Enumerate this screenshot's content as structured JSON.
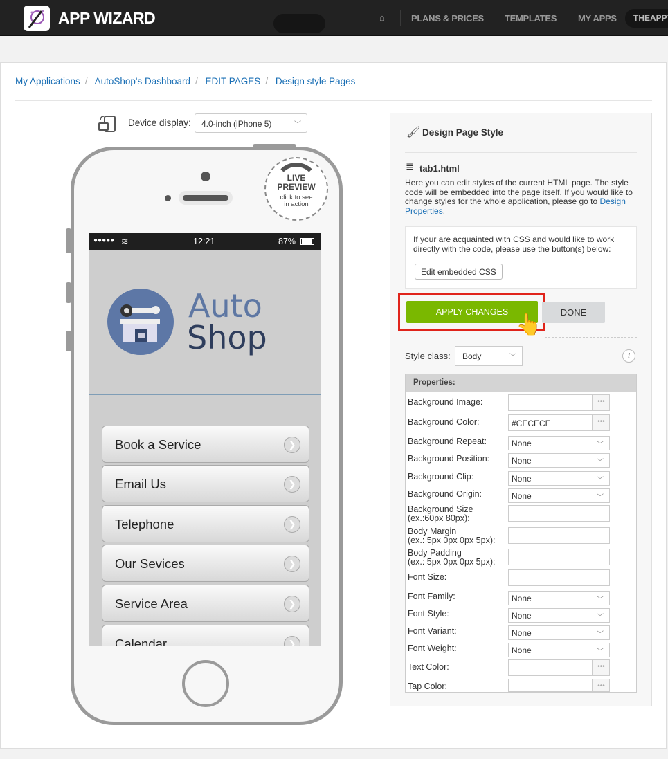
{
  "topbar": {
    "app_name": "APP WIZARD",
    "nav": [
      "PLANS & PRICES",
      "TEMPLATES",
      "MY APPS"
    ],
    "user": "THEAPPY"
  },
  "breadcrumb": [
    "My Applications",
    "AutoShop's Dashboard",
    "EDIT PAGES",
    "Design style Pages"
  ],
  "device": {
    "label": "Device display:",
    "selected": "4.0-inch (iPhone 5)"
  },
  "phone": {
    "badge": {
      "line1": "LIVE",
      "line2": "PREVIEW",
      "line3": "click to see",
      "line4": "in action"
    },
    "status": {
      "signal": "●●●●●",
      "time": "12:21",
      "battery": "87%"
    },
    "logo": {
      "line1": "Auto",
      "line2": "Shop"
    },
    "menu": [
      "Book a Service",
      "Email Us",
      "Telephone",
      "Our Sevices",
      "Service Area",
      "Calendar"
    ],
    "bg_color": "#CECECE"
  },
  "panel": {
    "title": "Design Page Style",
    "file": "tab1.html",
    "description": "Here you can edit styles of the current HTML page. The style code will be embedded into the page itself. If you would like to change styles for the whole application, please go to ",
    "link": "Design Properties",
    "link_suffix": ".",
    "css_note": "If your are acquainted with CSS and would like to work directly with the code, please use the button(s) below:",
    "edit_css": "Edit embedded CSS",
    "apply": "APPLY CHANGES",
    "done": "DONE",
    "style_class_label": "Style class:",
    "style_class": "Body",
    "properties_header": "Properties:",
    "properties": [
      {
        "label": "Background Image:",
        "type": "color",
        "value": ""
      },
      {
        "label": "Background Color:",
        "type": "color",
        "value": "#CECECE"
      },
      {
        "label": "Background Repeat:",
        "type": "select",
        "value": "None"
      },
      {
        "label": "Background Position:",
        "type": "select",
        "value": "None"
      },
      {
        "label": "Background Clip:",
        "type": "select",
        "value": "None"
      },
      {
        "label": "Background Origin:",
        "type": "select",
        "value": "None"
      },
      {
        "label": "Background Size",
        "sub": "(ex.:60px 80px):",
        "type": "text",
        "value": ""
      },
      {
        "label": "Body Margin",
        "sub": "(ex.: 5px 0px 0px 5px):",
        "type": "text",
        "value": ""
      },
      {
        "label": "Body Padding",
        "sub": "(ex.: 5px 0px 0px 5px):",
        "type": "text",
        "value": ""
      },
      {
        "label": "Font Size:",
        "type": "text",
        "value": ""
      },
      {
        "label": "Font Family:",
        "type": "select",
        "value": "None"
      },
      {
        "label": "Font Style:",
        "type": "select",
        "value": "None"
      },
      {
        "label": "Font Variant:",
        "type": "select",
        "value": "None"
      },
      {
        "label": "Font Weight:",
        "type": "select",
        "value": "None"
      },
      {
        "label": "Text Color:",
        "type": "color",
        "value": ""
      },
      {
        "label": "Tap Color:",
        "type": "color",
        "value": ""
      }
    ],
    "accent_green": "#7ab800",
    "highlight_red": "#e0241b"
  }
}
